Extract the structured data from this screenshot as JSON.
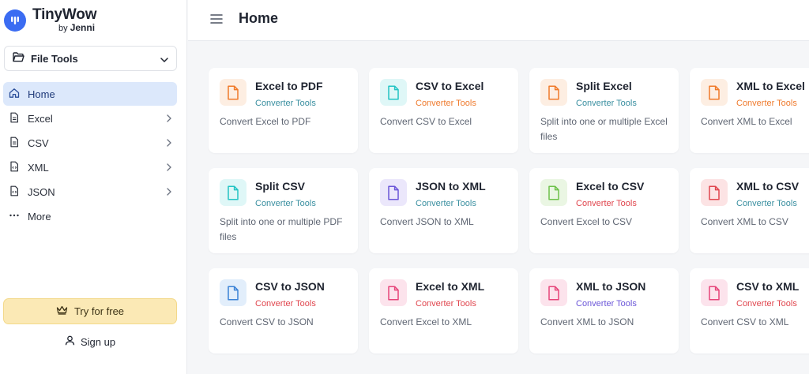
{
  "brand": {
    "name": "TinyWow",
    "by": "by",
    "author": "Jenni",
    "color": "#3b6cf2"
  },
  "category_select": {
    "label": "File Tools",
    "icon": "folder-open-icon"
  },
  "nav": {
    "items": [
      {
        "label": "Home",
        "icon": "home-icon",
        "active": true
      },
      {
        "label": "Excel",
        "icon": "document-icon",
        "chevron": true
      },
      {
        "label": "CSV",
        "icon": "document-icon",
        "chevron": true
      },
      {
        "label": "XML",
        "icon": "code-file-icon",
        "chevron": true
      },
      {
        "label": "JSON",
        "icon": "code-file-icon",
        "chevron": true
      },
      {
        "label": "More",
        "icon": "more-dots-icon"
      }
    ]
  },
  "try_button": {
    "label": "Try for free",
    "icon": "crown-icon"
  },
  "signup": {
    "label": "Sign up",
    "icon": "user-icon"
  },
  "header": {
    "title": "Home",
    "menu_icon": "hamburger-icon"
  },
  "tools": [
    {
      "title": "Excel to PDF",
      "category": "Converter Tools",
      "desc": "Convert Excel to PDF",
      "color": "#f07a2a",
      "bg": "#fdeee2",
      "cat_color": "#3a8fa0"
    },
    {
      "title": "CSV to Excel",
      "category": "Converter Tools",
      "desc": "Convert CSV to Excel",
      "color": "#23c4c4",
      "bg": "#dff7f7",
      "cat_color": "#ef7b2e"
    },
    {
      "title": "Split Excel",
      "category": "Converter Tools",
      "desc": "Split into one or multiple Excel files",
      "color": "#f07a2a",
      "bg": "#fdeee2",
      "cat_color": "#3a8fa0"
    },
    {
      "title": "XML to Excel",
      "category": "Converter Tools",
      "desc": "Convert XML to Excel",
      "color": "#f07a2a",
      "bg": "#fdeee2",
      "cat_color": "#ef7b2e"
    },
    {
      "title": "Split CSV",
      "category": "Converter Tools",
      "desc": "Split into one or multiple PDF files",
      "color": "#23c4c4",
      "bg": "#dff7f7",
      "cat_color": "#3a8fa0"
    },
    {
      "title": "JSON to XML",
      "category": "Converter Tools",
      "desc": "Convert JSON to XML",
      "color": "#6b56d8",
      "bg": "#ebe7fb",
      "cat_color": "#3a8fa0"
    },
    {
      "title": "Excel to CSV",
      "category": "Converter Tools",
      "desc": "Convert Excel to CSV",
      "color": "#6dc14a",
      "bg": "#eaf6e3",
      "cat_color": "#e0464e"
    },
    {
      "title": "XML to CSV",
      "category": "Converter Tools",
      "desc": "Convert XML to CSV",
      "color": "#e0464e",
      "bg": "#fce3e4",
      "cat_color": "#3a8fa0"
    },
    {
      "title": "CSV to JSON",
      "category": "Converter Tools",
      "desc": "Convert CSV to JSON",
      "color": "#3b82d6",
      "bg": "#e2eefb",
      "cat_color": "#e0464e"
    },
    {
      "title": "Excel to XML",
      "category": "Converter Tools",
      "desc": "Convert Excel to XML",
      "color": "#e6457a",
      "bg": "#fce3ec",
      "cat_color": "#e0464e"
    },
    {
      "title": "XML to JSON",
      "category": "Converter Tools",
      "desc": "Convert XML to JSON",
      "color": "#e6457a",
      "bg": "#fce3ec",
      "cat_color": "#6b56d8"
    },
    {
      "title": "CSV to XML",
      "category": "Converter Tools",
      "desc": "Convert CSV to XML",
      "color": "#e6457a",
      "bg": "#fce3ec",
      "cat_color": "#e0464e"
    }
  ]
}
